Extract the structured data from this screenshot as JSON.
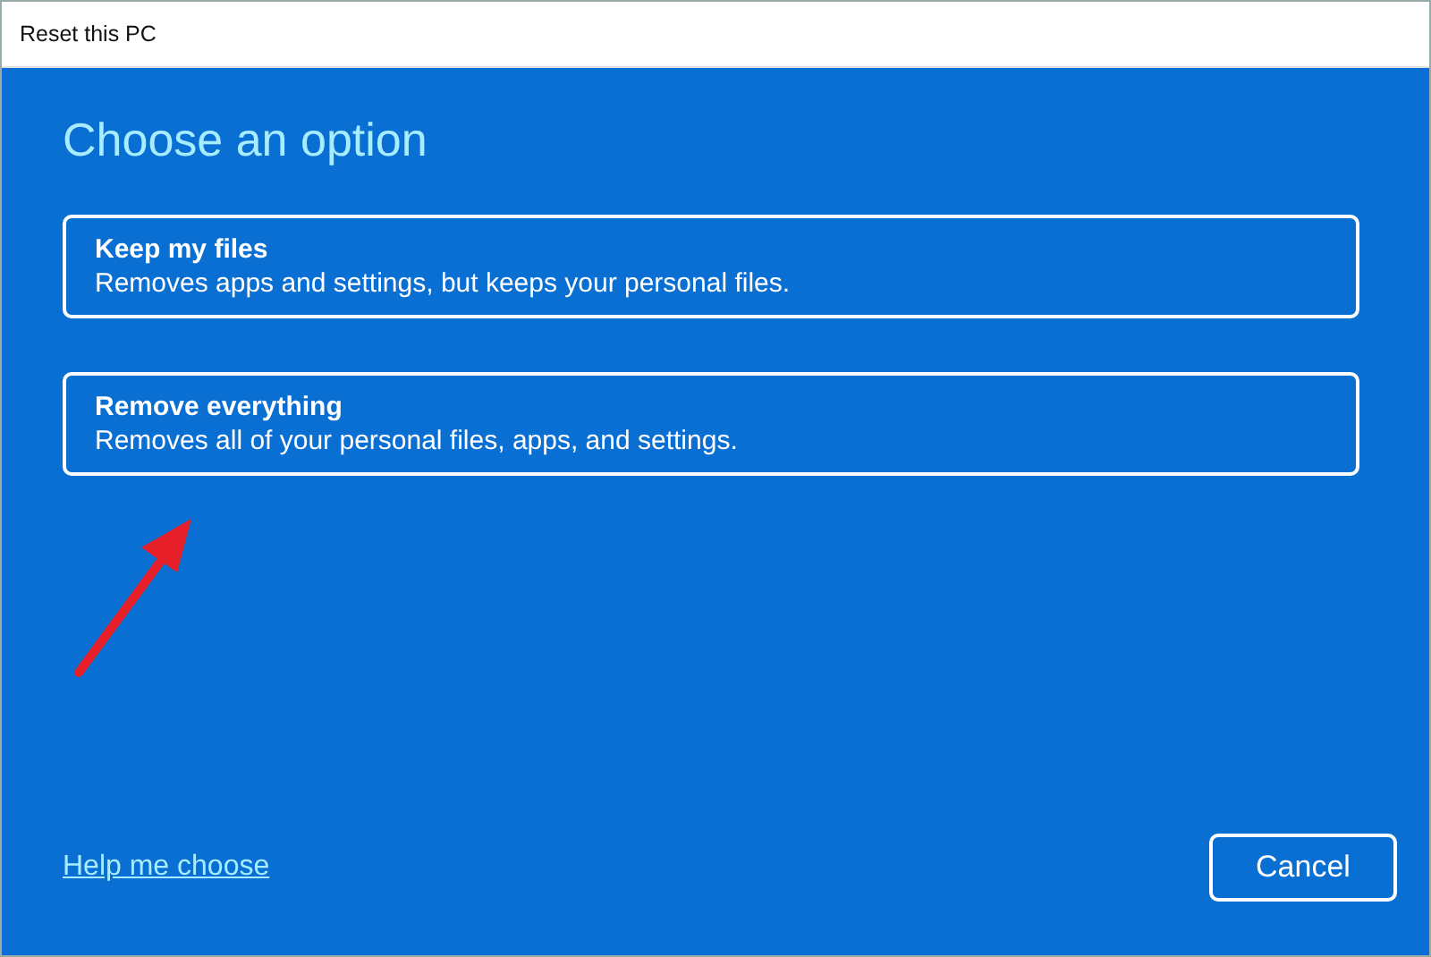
{
  "window": {
    "title": "Reset this PC"
  },
  "heading": "Choose an option",
  "options": [
    {
      "title": "Keep my files",
      "description": "Removes apps and settings, but keeps your personal files."
    },
    {
      "title": "Remove everything",
      "description": "Removes all of your personal files, apps, and settings."
    }
  ],
  "help_link": "Help me choose",
  "buttons": [
    "Cancel"
  ]
}
